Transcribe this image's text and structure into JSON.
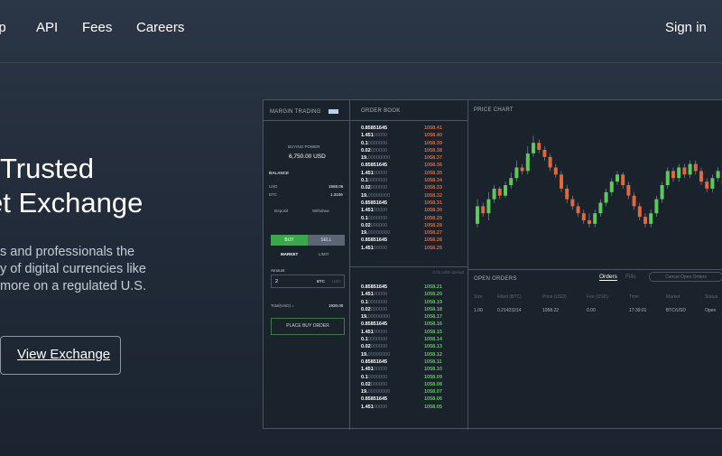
{
  "nav": {
    "items": [
      "lp",
      "API",
      "Fees",
      "Careers"
    ],
    "signin": "Sign in"
  },
  "hero": {
    "title_lines": [
      "Trusted",
      "et Exchange"
    ],
    "desc_lines": [
      "s and professionals the",
      "y of digital currencies like",
      "more on a regulated U.S."
    ],
    "cta": "View Exchange"
  },
  "mock": {
    "margin": {
      "title": "MARGIN TRADING",
      "buying_power_label": "BUYING POWER",
      "buying_power": "6,750.00 USD",
      "balance_label": "BALANCE",
      "balances": [
        {
          "cur": "USD",
          "val": "1568.06"
        },
        {
          "cur": "BTC",
          "val": "1.3106"
        }
      ],
      "deposit": "Deposit",
      "withdraw": "Withdraw",
      "buy": "BUY",
      "sell": "SELL",
      "market": "MARKET",
      "limit": "LIMIT",
      "amount_label": "Amount",
      "amount": "2",
      "amount_cur": "BTC",
      "amount_alt": "USD",
      "total_label": "Total(USD) =",
      "total": "1930.00",
      "place": "PLACE BUY ORDER"
    },
    "book": {
      "title": "ORDER BOOK",
      "asks": [
        {
          "q": "0.85851645",
          "p": "1058.41"
        },
        {
          "q": "1.451",
          "d": "00000",
          "p": "1058.40"
        },
        {
          "q": "0.1",
          "d": "0000000",
          "p": "1058.39"
        },
        {
          "q": "0.02",
          "d": "000000",
          "p": "1058.38"
        },
        {
          "q": "19.",
          "d": "00000000",
          "p": "1058.37"
        },
        {
          "q": "0.85851645",
          "p": "1058.36"
        },
        {
          "q": "1.451",
          "d": "00000",
          "p": "1058.35"
        },
        {
          "q": "0.1",
          "d": "0000000",
          "p": "1058.34"
        },
        {
          "q": "0.02",
          "d": "000000",
          "p": "1058.33"
        },
        {
          "q": "19.",
          "d": "00000000",
          "p": "1058.32"
        },
        {
          "q": "0.85851645",
          "p": "1058.31"
        },
        {
          "q": "1.451",
          "d": "00000",
          "p": "1058.30"
        },
        {
          "q": "0.1",
          "d": "0000000",
          "p": "1058.29"
        },
        {
          "q": "0.02",
          "d": "000000",
          "p": "1058.28"
        },
        {
          "q": "19.",
          "d": "00000000",
          "p": "1058.27"
        },
        {
          "q": "0.85851645",
          "p": "1058.26"
        },
        {
          "q": "1.451",
          "d": "00000",
          "p": "1058.25"
        }
      ],
      "spread": "0.01 USD spread",
      "bids": [
        {
          "q": "0.85851645",
          "p": "1058.21"
        },
        {
          "q": "1.451",
          "d": "00000",
          "p": "1058.20"
        },
        {
          "q": "0.1",
          "d": "0000000",
          "p": "1058.19"
        },
        {
          "q": "0.02",
          "d": "000000",
          "p": "1058.18"
        },
        {
          "q": "19.",
          "d": "00000000",
          "p": "1058.17"
        },
        {
          "q": "0.85851645",
          "p": "1058.16"
        },
        {
          "q": "1.451",
          "d": "00000",
          "p": "1058.15"
        },
        {
          "q": "0.1",
          "d": "0000000",
          "p": "1058.14"
        },
        {
          "q": "0.02",
          "d": "000000",
          "p": "1058.13"
        },
        {
          "q": "19.",
          "d": "00000000",
          "p": "1058.12"
        },
        {
          "q": "0.85851645",
          "p": "1058.11"
        },
        {
          "q": "1.451",
          "d": "00000",
          "p": "1058.10"
        },
        {
          "q": "0.1",
          "d": "0000000",
          "p": "1058.09"
        },
        {
          "q": "0.02",
          "d": "000000",
          "p": "1058.08"
        },
        {
          "q": "19.",
          "d": "00000000",
          "p": "1058.07"
        },
        {
          "q": "0.85851645",
          "p": "1058.06"
        },
        {
          "q": "1.451",
          "d": "00000",
          "p": "1058.05"
        }
      ]
    },
    "chart": {
      "title": "PRICE CHART",
      "up_color": "#5cc95c",
      "down_color": "#e0683a",
      "candles": [
        [
          45,
          70,
          40,
          80
        ],
        [
          70,
          60,
          55,
          75
        ],
        [
          60,
          80,
          50,
          90
        ],
        [
          80,
          95,
          75,
          100
        ],
        [
          95,
          85,
          80,
          98
        ],
        [
          85,
          100,
          82,
          105
        ],
        [
          100,
          110,
          95,
          118
        ],
        [
          110,
          125,
          105,
          135
        ],
        [
          125,
          120,
          115,
          130
        ],
        [
          120,
          145,
          115,
          155
        ],
        [
          145,
          160,
          140,
          170
        ],
        [
          160,
          150,
          145,
          165
        ],
        [
          150,
          140,
          135,
          155
        ],
        [
          140,
          125,
          120,
          145
        ],
        [
          125,
          115,
          110,
          130
        ],
        [
          115,
          95,
          90,
          120
        ],
        [
          95,
          80,
          75,
          100
        ],
        [
          80,
          70,
          65,
          85
        ],
        [
          70,
          60,
          55,
          75
        ],
        [
          60,
          50,
          45,
          65
        ],
        [
          50,
          45,
          40,
          60
        ],
        [
          45,
          60,
          40,
          65
        ],
        [
          60,
          75,
          55,
          80
        ],
        [
          75,
          90,
          70,
          95
        ],
        [
          90,
          105,
          85,
          110
        ],
        [
          105,
          115,
          100,
          120
        ],
        [
          115,
          100,
          95,
          118
        ],
        [
          100,
          85,
          80,
          105
        ],
        [
          85,
          70,
          65,
          90
        ],
        [
          70,
          55,
          50,
          75
        ],
        [
          55,
          45,
          40,
          60
        ],
        [
          45,
          60,
          40,
          65
        ],
        [
          60,
          80,
          55,
          85
        ],
        [
          80,
          100,
          75,
          105
        ],
        [
          100,
          120,
          95,
          125
        ],
        [
          120,
          110,
          105,
          125
        ],
        [
          110,
          125,
          105,
          130
        ],
        [
          125,
          115,
          110,
          130
        ],
        [
          115,
          130,
          110,
          135
        ],
        [
          130,
          120,
          115,
          135
        ],
        [
          120,
          105,
          100,
          125
        ],
        [
          105,
          95,
          90,
          110
        ],
        [
          95,
          110,
          90,
          115
        ],
        [
          110,
          120,
          105,
          125
        ],
        [
          120,
          100,
          95,
          125
        ],
        [
          100,
          90,
          85,
          105
        ]
      ]
    },
    "orders": {
      "title": "OPEN ORDERS",
      "tab_orders": "Orders",
      "tab_fills": "Fills",
      "cancel": "Cancel Open Orders",
      "head": [
        "Size",
        "Filled (BTC)",
        "Price (USD)",
        "Fee (USD)",
        "Time",
        "Market",
        "Status"
      ],
      "row": [
        "1.00",
        "0.21423214",
        "1058.22",
        "0.00",
        "17:39:01",
        "BTC/USD",
        "Open"
      ]
    }
  }
}
